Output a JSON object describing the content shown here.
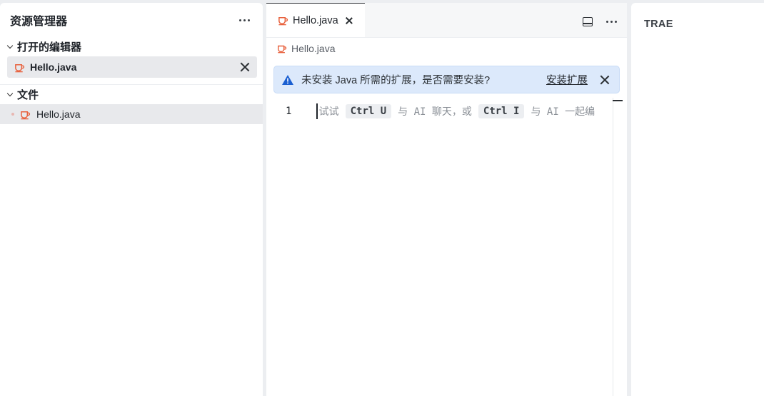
{
  "explorer": {
    "title": "资源管理器",
    "open_editors": {
      "label": "打开的编辑器",
      "items": [
        {
          "label": "Hello.java",
          "icon": "java-cup-icon"
        }
      ]
    },
    "files": {
      "label": "文件",
      "items": [
        {
          "label": "Hello.java",
          "icon": "java-cup-icon"
        }
      ]
    }
  },
  "editor": {
    "tab": {
      "label": "Hello.java"
    },
    "breadcrumb": "Hello.java",
    "banner": {
      "message": "未安装 Java 所需的扩展，是否需要安装?",
      "action": "安装扩展"
    },
    "line_number": "1",
    "hint": {
      "t1": "试试",
      "k1": "Ctrl U",
      "t2": "与 AI 聊天，或",
      "k2": "Ctrl I",
      "t3": "与 AI 一起编"
    }
  },
  "right_panel": {
    "title": "TRAE"
  },
  "colors": {
    "java_icon": "#e8603c",
    "banner_bg": "#dce9fb",
    "warn_icon": "#1a5fd1"
  }
}
